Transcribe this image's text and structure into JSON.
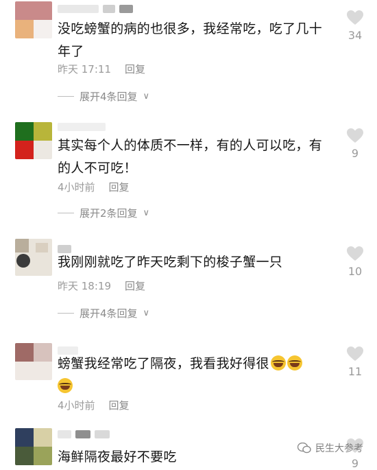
{
  "comments": [
    {
      "text": "没吃螃蟹的病的也很多，我经常吃，吃了几十年了",
      "time": "昨天 17:11",
      "reply_label": "回复",
      "expand_label": "展开4条回复",
      "likes": "34"
    },
    {
      "text": "其实每个人的体质不一样，有的人可以吃，有的人不可吃！",
      "time": "4小时前",
      "reply_label": "回复",
      "expand_label": "展开2条回复",
      "likes": "9"
    },
    {
      "text": "我刚刚就吃了昨天吃剩下的梭子蟹一只",
      "time": "昨天 18:19",
      "reply_label": "回复",
      "expand_label": "展开4条回复",
      "likes": "10"
    },
    {
      "text": "螃蟹我经常吃了隔夜，我看我好得很",
      "time": "4小时前",
      "reply_label": "回复",
      "likes": "11"
    },
    {
      "text": "海鲜隔夜最好不要吃",
      "likes": "9"
    }
  ],
  "watermark": "民生大参考",
  "colors": {
    "heart": "#d9d9d9",
    "meta": "#9a9a9a",
    "emoji": "#f6c531"
  }
}
